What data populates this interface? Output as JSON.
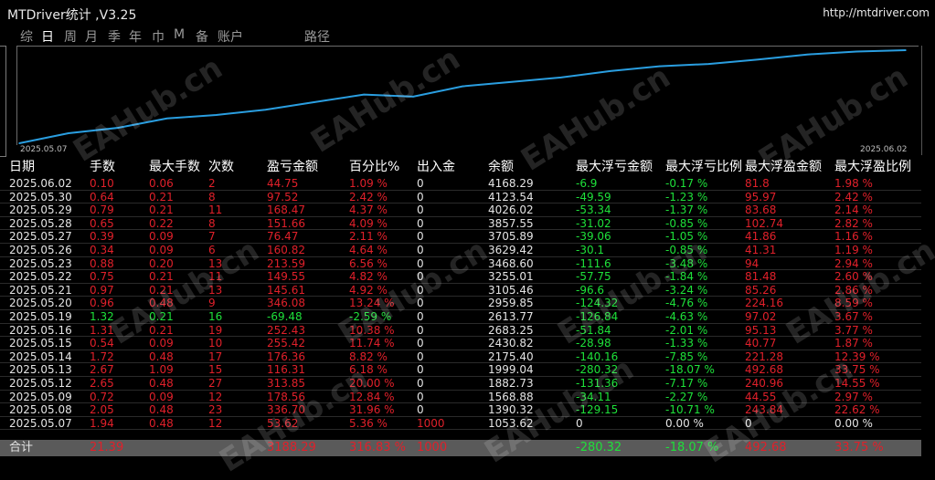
{
  "window": {
    "title": "MTDriver统计 ,V3.25",
    "url": "http://mtdriver.com"
  },
  "tabs": [
    "综",
    "日",
    "周",
    "月",
    "季",
    "年",
    "巾",
    "M",
    "备",
    "账户",
    "路径"
  ],
  "active_tab": 1,
  "colors": {
    "positive": "#e0202a",
    "negative": "#1ee03a",
    "neutral": "#e4e4e4",
    "curve": "#2a9ee0"
  },
  "chart_data": {
    "type": "line",
    "x_start_label": "2025.05.07",
    "x_end_label": "2025.06.02",
    "series": [
      {
        "x": [
          "2025.05.07",
          "2025.05.08",
          "2025.05.09",
          "2025.05.12",
          "2025.05.13",
          "2025.05.14",
          "2025.05.15",
          "2025.05.16",
          "2025.05.19",
          "2025.05.20",
          "2025.05.21",
          "2025.05.22",
          "2025.05.23",
          "2025.05.26",
          "2025.05.27",
          "2025.05.28",
          "2025.05.29",
          "2025.05.30",
          "2025.06.02"
        ],
        "y": [
          1053.62,
          1390.32,
          1568.88,
          1882.73,
          1999.04,
          2175.4,
          2430.82,
          2683.25,
          2613.77,
          2959.85,
          3105.46,
          3255.01,
          3468.6,
          3629.42,
          3705.89,
          3857.55,
          4026.02,
          4123.54,
          4168.29
        ]
      }
    ]
  },
  "table": {
    "headers": [
      "日期",
      "手数",
      "最大手数",
      "次数",
      "盈亏金额",
      "百分比%",
      "出入金",
      "余额",
      "最大浮亏金额",
      "最大浮亏比例",
      "最大浮盈金额",
      "最大浮盈比例"
    ],
    "rows": [
      [
        "2025.06.02",
        "0.10",
        "0.06",
        "2",
        "44.75",
        "1.09 %",
        "0",
        "4168.29",
        "-6.9",
        "-0.17 %",
        "81.8",
        "1.98 %"
      ],
      [
        "2025.05.30",
        "0.64",
        "0.21",
        "8",
        "97.52",
        "2.42 %",
        "0",
        "4123.54",
        "-49.59",
        "-1.23 %",
        "95.97",
        "2.42 %"
      ],
      [
        "2025.05.29",
        "0.79",
        "0.21",
        "11",
        "168.47",
        "4.37 %",
        "0",
        "4026.02",
        "-53.34",
        "-1.37 %",
        "83.68",
        "2.14 %"
      ],
      [
        "2025.05.28",
        "0.65",
        "0.22",
        "8",
        "151.66",
        "4.09 %",
        "0",
        "3857.55",
        "-31.02",
        "-0.85 %",
        "102.74",
        "2.82 %"
      ],
      [
        "2025.05.27",
        "0.39",
        "0.09",
        "7",
        "76.47",
        "2.11 %",
        "0",
        "3705.89",
        "-39.06",
        "-1.05 %",
        "41.86",
        "1.16 %"
      ],
      [
        "2025.05.26",
        "0.34",
        "0.09",
        "6",
        "160.82",
        "4.64 %",
        "0",
        "3629.42",
        "-30.1",
        "-0.85 %",
        "41.31",
        "1.19 %"
      ],
      [
        "2025.05.23",
        "0.88",
        "0.20",
        "13",
        "213.59",
        "6.56 %",
        "0",
        "3468.60",
        "-111.6",
        "-3.48 %",
        "94",
        "2.94 %"
      ],
      [
        "2025.05.22",
        "0.75",
        "0.21",
        "11",
        "149.55",
        "4.82 %",
        "0",
        "3255.01",
        "-57.75",
        "-1.84 %",
        "81.48",
        "2.60 %"
      ],
      [
        "2025.05.21",
        "0.97",
        "0.21",
        "13",
        "145.61",
        "4.92 %",
        "0",
        "3105.46",
        "-96.6",
        "-3.24 %",
        "85.26",
        "2.86 %"
      ],
      [
        "2025.05.20",
        "0.96",
        "0.48",
        "9",
        "346.08",
        "13.24 %",
        "0",
        "2959.85",
        "-124.32",
        "-4.76 %",
        "224.16",
        "8.59 %"
      ],
      [
        "2025.05.19",
        "1.32",
        "0.21",
        "16",
        "-69.48",
        "-2.59 %",
        "0",
        "2613.77",
        "-126.84",
        "-4.63 %",
        "97.02",
        "3.67 %"
      ],
      [
        "2025.05.16",
        "1.31",
        "0.21",
        "19",
        "252.43",
        "10.38 %",
        "0",
        "2683.25",
        "-51.84",
        "-2.01 %",
        "95.13",
        "3.77 %"
      ],
      [
        "2025.05.15",
        "0.54",
        "0.09",
        "10",
        "255.42",
        "11.74 %",
        "0",
        "2430.82",
        "-28.98",
        "-1.33 %",
        "40.77",
        "1.87 %"
      ],
      [
        "2025.05.14",
        "1.72",
        "0.48",
        "17",
        "176.36",
        "8.82 %",
        "0",
        "2175.40",
        "-140.16",
        "-7.85 %",
        "221.28",
        "12.39 %"
      ],
      [
        "2025.05.13",
        "2.67",
        "1.09",
        "15",
        "116.31",
        "6.18 %",
        "0",
        "1999.04",
        "-280.32",
        "-18.07 %",
        "492.68",
        "33.75 %"
      ],
      [
        "2025.05.12",
        "2.65",
        "0.48",
        "27",
        "313.85",
        "20.00 %",
        "0",
        "1882.73",
        "-131.36",
        "-7.17 %",
        "240.96",
        "14.55 %"
      ],
      [
        "2025.05.09",
        "0.72",
        "0.09",
        "12",
        "178.56",
        "12.84 %",
        "0",
        "1568.88",
        "-34.11",
        "-2.27 %",
        "44.55",
        "2.97 %"
      ],
      [
        "2025.05.08",
        "2.05",
        "0.48",
        "23",
        "336.70",
        "31.96 %",
        "0",
        "1390.32",
        "-129.15",
        "-10.71 %",
        "243.84",
        "22.62 %"
      ],
      [
        "2025.05.07",
        "1.94",
        "0.48",
        "12",
        "53.62",
        "5.36 %",
        "1000",
        "1053.62",
        "0",
        "0.00 %",
        "0",
        "0.00 %"
      ]
    ],
    "summary": [
      "合计",
      "21.39",
      "",
      "",
      "3188.29",
      "316.83 %",
      "1000",
      "",
      "-280.32",
      "-18.07 %",
      "492.68",
      "33.75 %"
    ]
  },
  "watermark": "EAHub.cn"
}
